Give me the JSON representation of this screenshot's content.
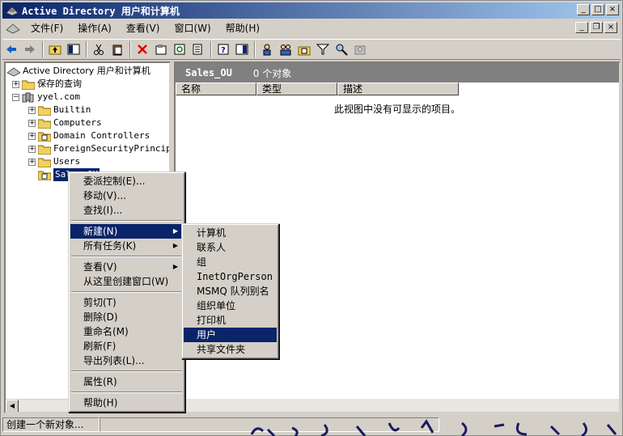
{
  "window": {
    "title": "Active Directory 用户和计算机"
  },
  "menubar": {
    "items": [
      "文件(F)",
      "操作(A)",
      "查看(V)",
      "窗口(W)",
      "帮助(H)"
    ]
  },
  "tree": {
    "root": "Active Directory 用户和计算机",
    "saved_queries": "保存的查询",
    "domain": "yyel.com",
    "children": [
      "Builtin",
      "Computers",
      "Domain Controllers",
      "ForeignSecurityPrincipal",
      "Users",
      "Sales_OU"
    ]
  },
  "right": {
    "ou_name": "Sales_OU",
    "count": "0 个对象",
    "columns": [
      "名称",
      "类型",
      "描述"
    ],
    "empty_message": "此视图中没有可显示的项目。"
  },
  "context_menu": {
    "items": [
      "委派控制(E)...",
      "移动(V)...",
      "查找(I)...",
      "新建(N)",
      "所有任务(K)",
      "查看(V)",
      "从这里创建窗口(W)",
      "剪切(T)",
      "删除(D)",
      "重命名(M)",
      "刷新(F)",
      "导出列表(L)...",
      "属性(R)",
      "帮助(H)"
    ]
  },
  "submenu": {
    "items": [
      "计算机",
      "联系人",
      "组",
      "InetOrgPerson",
      "MSMQ 队列别名",
      "组织单位",
      "打印机",
      "用户",
      "共享文件夹"
    ]
  },
  "status": {
    "text": "创建一个新对象..."
  },
  "colors": {
    "title_start": "#0a246a",
    "title_end": "#a6caf0",
    "highlight": "#0a246a",
    "face": "#d4d0c8"
  }
}
